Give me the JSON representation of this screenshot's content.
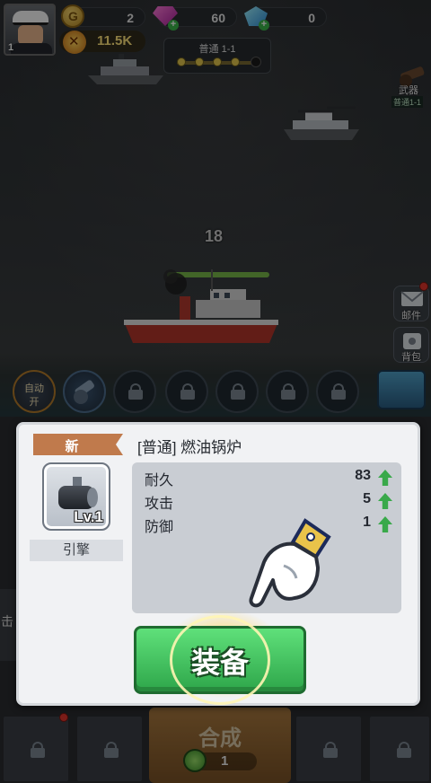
{
  "top_bar": {
    "player_level": "1",
    "coins": "2",
    "gems": "60",
    "crystals": "0",
    "power": "11.5K",
    "stage_name": "普通 1-1"
  },
  "side": {
    "weapon_label": "武器",
    "weapon_sub": "普通1-1",
    "mail_label": "邮件",
    "bag_label": "背包"
  },
  "battle": {
    "damage_number": "18",
    "enemy_hp_fraction": 1.0
  },
  "skills": {
    "auto_label_1": "自动",
    "auto_label_2": "开"
  },
  "popup": {
    "new_tag": "新",
    "item_name": "[普通] 燃油锅炉",
    "item_level": "Lv.1",
    "item_type": "引擎",
    "stats": [
      {
        "name": "耐久",
        "value": "83"
      },
      {
        "name": "攻击",
        "value": "5"
      },
      {
        "name": "防御",
        "value": "1"
      }
    ],
    "equip_label": "装备"
  },
  "bottom": {
    "merge_label": "合成",
    "merge_count": "1",
    "left_edge_text": "击"
  },
  "colors": {
    "equip_green": "#3cc75a",
    "new_tag": "#c07a4c",
    "stat_up": "#39a94a"
  }
}
